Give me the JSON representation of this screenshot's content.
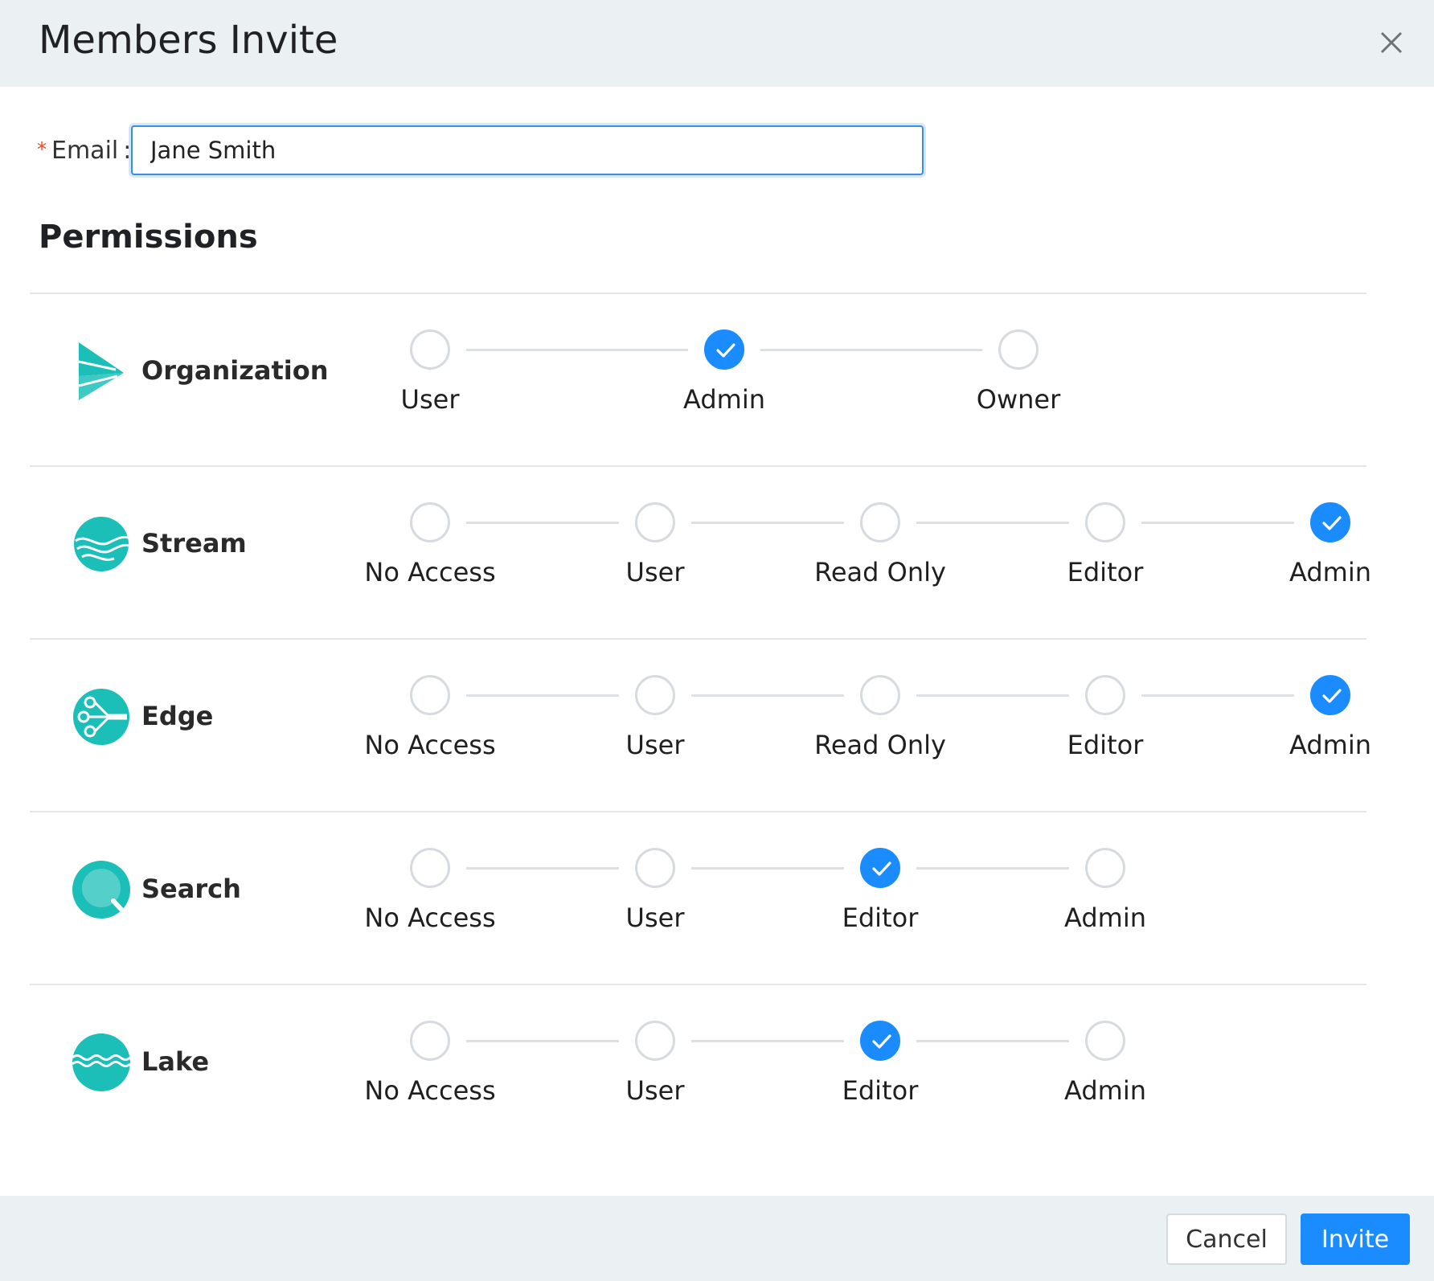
{
  "dialog": {
    "title": "Members Invite"
  },
  "email": {
    "required_mark": "*",
    "label": "Email",
    "colon": ":",
    "value": "Jane Smith"
  },
  "permissions_title": "Permissions",
  "products": [
    {
      "name": "Organization",
      "icon": "organization-logo-icon",
      "levels": [
        "User",
        "Admin",
        "Owner"
      ],
      "selected": "Admin"
    },
    {
      "name": "Stream",
      "icon": "stream-logo-icon",
      "levels": [
        "No Access",
        "User",
        "Read Only",
        "Editor",
        "Admin"
      ],
      "selected": "Admin"
    },
    {
      "name": "Edge",
      "icon": "edge-logo-icon",
      "levels": [
        "No Access",
        "User",
        "Read Only",
        "Editor",
        "Admin"
      ],
      "selected": "Admin"
    },
    {
      "name": "Search",
      "icon": "search-logo-icon",
      "levels": [
        "No Access",
        "User",
        "Editor",
        "Admin"
      ],
      "selected": "Editor"
    },
    {
      "name": "Lake",
      "icon": "lake-logo-icon",
      "levels": [
        "No Access",
        "User",
        "Editor",
        "Admin"
      ],
      "selected": "Editor"
    }
  ],
  "footer": {
    "cancel_label": "Cancel",
    "invite_label": "Invite"
  },
  "colors": {
    "accent": "#1a8cff",
    "logo": "#1cbfb8",
    "header_bg": "#ebf1f3"
  }
}
